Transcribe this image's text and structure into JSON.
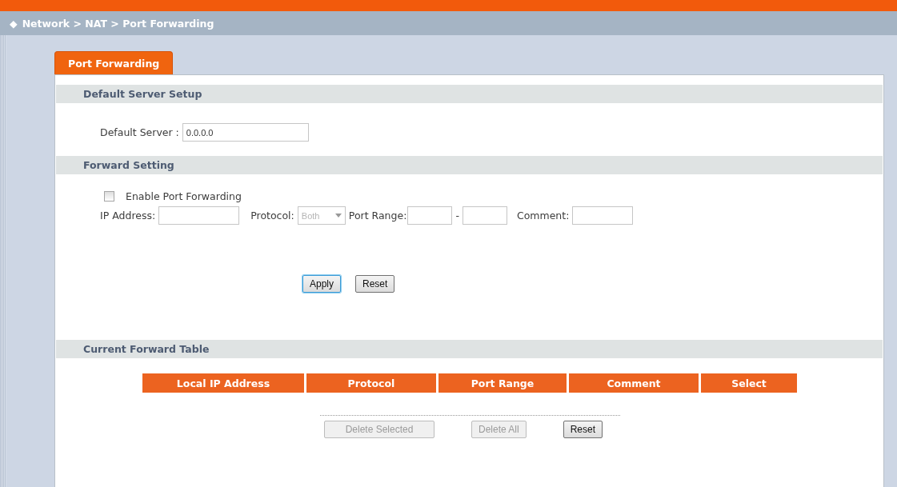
{
  "breadcrumb": {
    "icon": "◆",
    "text": "Network > NAT > Port Forwarding"
  },
  "tabs": [
    {
      "label": "Port Forwarding",
      "selected": true
    }
  ],
  "default_server_section": {
    "title": "Default Server Setup",
    "label": "Default Server :",
    "value": "0.0.0.0"
  },
  "forward_setting_section": {
    "title": "Forward Setting",
    "enable": {
      "label": "Enable Port Forwarding",
      "checked": false
    },
    "ip_label": "IP Address:",
    "protocol_label": "Protocol:",
    "protocol": {
      "value": "Both",
      "disabled": true
    },
    "port_range_label": "Port Range:",
    "range_separator": "-",
    "comment_label": "Comment:",
    "buttons": [
      {
        "label": "Apply",
        "focused": true,
        "disabled": false
      },
      {
        "label": "Reset",
        "focused": false,
        "disabled": false
      }
    ]
  },
  "forward_table_section": {
    "title": "Current Forward Table",
    "columns": [
      "Local IP Address",
      "Protocol",
      "Port Range",
      "Comment",
      "Select"
    ],
    "buttons": [
      {
        "label": "Delete Selected",
        "disabled": true
      },
      {
        "label": "Delete All",
        "disabled": true
      },
      {
        "label": "Reset",
        "disabled": false
      }
    ]
  }
}
